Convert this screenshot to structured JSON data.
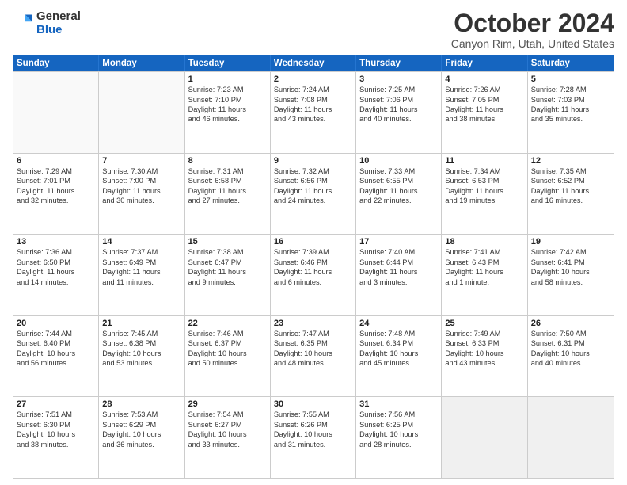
{
  "header": {
    "logo_line1": "General",
    "logo_line2": "Blue",
    "title": "October 2024",
    "subtitle": "Canyon Rim, Utah, United States"
  },
  "weekdays": [
    "Sunday",
    "Monday",
    "Tuesday",
    "Wednesday",
    "Thursday",
    "Friday",
    "Saturday"
  ],
  "weeks": [
    [
      {
        "day": "",
        "lines": [],
        "empty": true
      },
      {
        "day": "",
        "lines": [],
        "empty": true
      },
      {
        "day": "1",
        "lines": [
          "Sunrise: 7:23 AM",
          "Sunset: 7:10 PM",
          "Daylight: 11 hours",
          "and 46 minutes."
        ]
      },
      {
        "day": "2",
        "lines": [
          "Sunrise: 7:24 AM",
          "Sunset: 7:08 PM",
          "Daylight: 11 hours",
          "and 43 minutes."
        ]
      },
      {
        "day": "3",
        "lines": [
          "Sunrise: 7:25 AM",
          "Sunset: 7:06 PM",
          "Daylight: 11 hours",
          "and 40 minutes."
        ]
      },
      {
        "day": "4",
        "lines": [
          "Sunrise: 7:26 AM",
          "Sunset: 7:05 PM",
          "Daylight: 11 hours",
          "and 38 minutes."
        ]
      },
      {
        "day": "5",
        "lines": [
          "Sunrise: 7:28 AM",
          "Sunset: 7:03 PM",
          "Daylight: 11 hours",
          "and 35 minutes."
        ]
      }
    ],
    [
      {
        "day": "6",
        "lines": [
          "Sunrise: 7:29 AM",
          "Sunset: 7:01 PM",
          "Daylight: 11 hours",
          "and 32 minutes."
        ]
      },
      {
        "day": "7",
        "lines": [
          "Sunrise: 7:30 AM",
          "Sunset: 7:00 PM",
          "Daylight: 11 hours",
          "and 30 minutes."
        ]
      },
      {
        "day": "8",
        "lines": [
          "Sunrise: 7:31 AM",
          "Sunset: 6:58 PM",
          "Daylight: 11 hours",
          "and 27 minutes."
        ]
      },
      {
        "day": "9",
        "lines": [
          "Sunrise: 7:32 AM",
          "Sunset: 6:56 PM",
          "Daylight: 11 hours",
          "and 24 minutes."
        ]
      },
      {
        "day": "10",
        "lines": [
          "Sunrise: 7:33 AM",
          "Sunset: 6:55 PM",
          "Daylight: 11 hours",
          "and 22 minutes."
        ]
      },
      {
        "day": "11",
        "lines": [
          "Sunrise: 7:34 AM",
          "Sunset: 6:53 PM",
          "Daylight: 11 hours",
          "and 19 minutes."
        ]
      },
      {
        "day": "12",
        "lines": [
          "Sunrise: 7:35 AM",
          "Sunset: 6:52 PM",
          "Daylight: 11 hours",
          "and 16 minutes."
        ]
      }
    ],
    [
      {
        "day": "13",
        "lines": [
          "Sunrise: 7:36 AM",
          "Sunset: 6:50 PM",
          "Daylight: 11 hours",
          "and 14 minutes."
        ]
      },
      {
        "day": "14",
        "lines": [
          "Sunrise: 7:37 AM",
          "Sunset: 6:49 PM",
          "Daylight: 11 hours",
          "and 11 minutes."
        ]
      },
      {
        "day": "15",
        "lines": [
          "Sunrise: 7:38 AM",
          "Sunset: 6:47 PM",
          "Daylight: 11 hours",
          "and 9 minutes."
        ]
      },
      {
        "day": "16",
        "lines": [
          "Sunrise: 7:39 AM",
          "Sunset: 6:46 PM",
          "Daylight: 11 hours",
          "and 6 minutes."
        ]
      },
      {
        "day": "17",
        "lines": [
          "Sunrise: 7:40 AM",
          "Sunset: 6:44 PM",
          "Daylight: 11 hours",
          "and 3 minutes."
        ]
      },
      {
        "day": "18",
        "lines": [
          "Sunrise: 7:41 AM",
          "Sunset: 6:43 PM",
          "Daylight: 11 hours",
          "and 1 minute."
        ]
      },
      {
        "day": "19",
        "lines": [
          "Sunrise: 7:42 AM",
          "Sunset: 6:41 PM",
          "Daylight: 10 hours",
          "and 58 minutes."
        ]
      }
    ],
    [
      {
        "day": "20",
        "lines": [
          "Sunrise: 7:44 AM",
          "Sunset: 6:40 PM",
          "Daylight: 10 hours",
          "and 56 minutes."
        ]
      },
      {
        "day": "21",
        "lines": [
          "Sunrise: 7:45 AM",
          "Sunset: 6:38 PM",
          "Daylight: 10 hours",
          "and 53 minutes."
        ]
      },
      {
        "day": "22",
        "lines": [
          "Sunrise: 7:46 AM",
          "Sunset: 6:37 PM",
          "Daylight: 10 hours",
          "and 50 minutes."
        ]
      },
      {
        "day": "23",
        "lines": [
          "Sunrise: 7:47 AM",
          "Sunset: 6:35 PM",
          "Daylight: 10 hours",
          "and 48 minutes."
        ]
      },
      {
        "day": "24",
        "lines": [
          "Sunrise: 7:48 AM",
          "Sunset: 6:34 PM",
          "Daylight: 10 hours",
          "and 45 minutes."
        ]
      },
      {
        "day": "25",
        "lines": [
          "Sunrise: 7:49 AM",
          "Sunset: 6:33 PM",
          "Daylight: 10 hours",
          "and 43 minutes."
        ]
      },
      {
        "day": "26",
        "lines": [
          "Sunrise: 7:50 AM",
          "Sunset: 6:31 PM",
          "Daylight: 10 hours",
          "and 40 minutes."
        ]
      }
    ],
    [
      {
        "day": "27",
        "lines": [
          "Sunrise: 7:51 AM",
          "Sunset: 6:30 PM",
          "Daylight: 10 hours",
          "and 38 minutes."
        ]
      },
      {
        "day": "28",
        "lines": [
          "Sunrise: 7:53 AM",
          "Sunset: 6:29 PM",
          "Daylight: 10 hours",
          "and 36 minutes."
        ]
      },
      {
        "day": "29",
        "lines": [
          "Sunrise: 7:54 AM",
          "Sunset: 6:27 PM",
          "Daylight: 10 hours",
          "and 33 minutes."
        ]
      },
      {
        "day": "30",
        "lines": [
          "Sunrise: 7:55 AM",
          "Sunset: 6:26 PM",
          "Daylight: 10 hours",
          "and 31 minutes."
        ]
      },
      {
        "day": "31",
        "lines": [
          "Sunrise: 7:56 AM",
          "Sunset: 6:25 PM",
          "Daylight: 10 hours",
          "and 28 minutes."
        ]
      },
      {
        "day": "",
        "lines": [],
        "empty": true,
        "shaded": true
      },
      {
        "day": "",
        "lines": [],
        "empty": true,
        "shaded": true
      }
    ]
  ]
}
